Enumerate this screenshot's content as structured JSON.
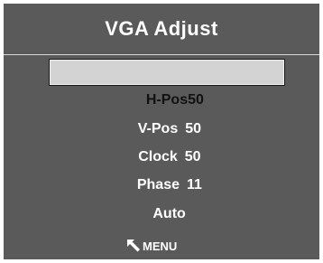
{
  "osd": {
    "title": "VGA Adjust",
    "items": [
      {
        "label": "H-Pos",
        "value": "50",
        "selected": true
      },
      {
        "label": "V-Pos",
        "value": "50",
        "selected": false
      },
      {
        "label": "Clock",
        "value": "50",
        "selected": false
      },
      {
        "label": "Phase",
        "value": "11",
        "selected": false
      },
      {
        "label": "Auto",
        "value": "",
        "selected": false
      }
    ],
    "footer": {
      "icon": "back-arrow-icon",
      "label": "MENU"
    }
  },
  "colors": {
    "panel": "#5a5a5a",
    "highlight": "#d3d3d3",
    "text": "#ffffff"
  }
}
